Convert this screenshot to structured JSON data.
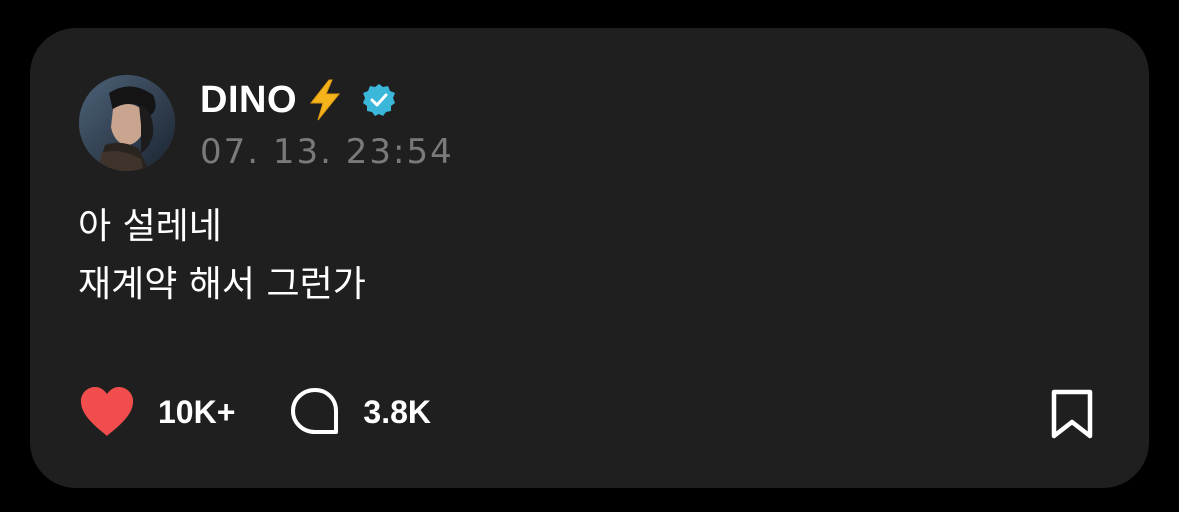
{
  "post": {
    "author": {
      "name": "DINO",
      "emoji_icon": "lightning-bolt-icon",
      "verified_icon": "verified-badge-icon",
      "avatar": "avatar"
    },
    "timestamp": "07. 13. 23:54",
    "body_lines": [
      "아 설레네",
      "재계약 해서 그런가"
    ],
    "actions": {
      "like_icon": "heart-icon",
      "like_count": "10K+",
      "comment_icon": "comment-bubble-icon",
      "comment_count": "3.8K",
      "bookmark_icon": "bookmark-icon"
    }
  },
  "colors": {
    "background": "#000000",
    "card": "#1f1f1f",
    "text_primary": "#ffffff",
    "text_secondary": "#7a7a7a",
    "heart": "#f24d4d",
    "verified": "#3ab7d9",
    "bolt": "#f5b31c"
  }
}
